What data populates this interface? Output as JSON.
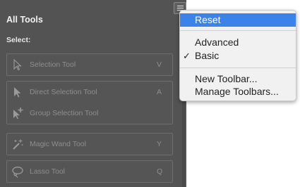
{
  "panel": {
    "title": "All Tools",
    "select_label": "Select:",
    "tools": [
      {
        "name": "Selection Tool",
        "shortcut": "V",
        "icon": "selection-arrow-icon"
      },
      {
        "name": "Direct Selection Tool",
        "shortcut": "A",
        "icon": "direct-selection-arrow-icon"
      },
      {
        "name": "Group Selection Tool",
        "shortcut": "",
        "icon": "group-selection-icon"
      },
      {
        "name": "Magic Wand Tool",
        "shortcut": "Y",
        "icon": "magic-wand-icon"
      },
      {
        "name": "Lasso Tool",
        "shortcut": "Q",
        "icon": "lasso-icon"
      }
    ]
  },
  "menu": {
    "items": [
      {
        "label": "Reset",
        "highlighted": true
      },
      {
        "label": "Advanced"
      },
      {
        "label": "Basic",
        "checked": true,
        "check_mark": "✓"
      },
      {
        "label": "New Toolbar..."
      },
      {
        "label": "Manage Toolbars..."
      }
    ]
  },
  "colors": {
    "panel_bg": "#535353",
    "menu_highlight": "#3b83e8",
    "menu_bg": "#f1f1f1"
  }
}
